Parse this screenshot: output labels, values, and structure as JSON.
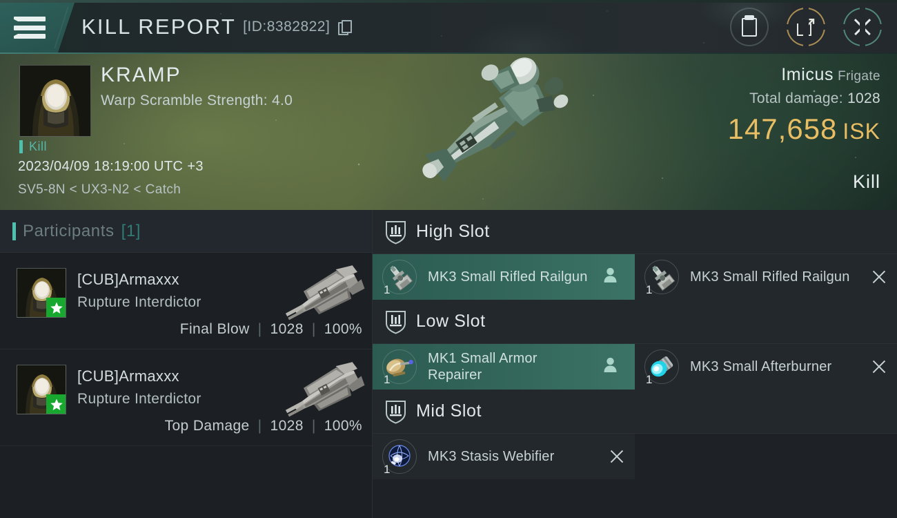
{
  "header": {
    "menu_icon": "hamburger-menu-icon",
    "title": "KILL REPORT",
    "report_id": "[ID:8382822]",
    "copy_icon": "copy-icon",
    "actions": [
      {
        "name": "clipboard-button",
        "icon": "clipboard-icon"
      },
      {
        "name": "share-button",
        "icon": "share-external-link-icon"
      },
      {
        "name": "close-button",
        "icon": "close-x-icon"
      }
    ]
  },
  "hero": {
    "victim_name": "KRAMP",
    "victim_stat": "Warp Scramble Strength: 4.0",
    "result_tag": "Kill",
    "timestamp": "2023/04/09 18:19:00 UTC +3",
    "location": "SV5-8N < UX3-N2 < Catch",
    "ship_name": "Imicus",
    "ship_class": "Frigate",
    "damage_label": "Total damage:",
    "damage_value": "1028",
    "isk_value": "147,658",
    "isk_unit": "ISK",
    "result_label": "Kill",
    "isk_color": "#e8bd63",
    "accent_color": "#4fbfae",
    "portrait_icon": "capsuleer-portrait",
    "ship_render_icon": "imicus-frigate-render"
  },
  "participants": {
    "title": "Participants",
    "count": "[1]",
    "rows": [
      {
        "name": "[CUB]Armaxxx",
        "ship": "Rupture Interdictor",
        "role": "Final Blow",
        "damage": "1028",
        "percent": "100%",
        "badge_icon": "star-badge-icon",
        "avatar_icon": "capsuleer-portrait",
        "ship_icon": "rupture-cruiser-thumbnail"
      },
      {
        "name": "[CUB]Armaxxx",
        "ship": "Rupture Interdictor",
        "role": "Top Damage",
        "damage": "1028",
        "percent": "100%",
        "badge_icon": "star-badge-icon",
        "avatar_icon": "capsuleer-portrait",
        "ship_icon": "rupture-cruiser-thumbnail"
      }
    ]
  },
  "slots": [
    {
      "title": "High Slot",
      "icon": "high-slot-shield-icon",
      "items": [
        {
          "name": "MK3 Small Rifled Railgun",
          "qty": "1",
          "state": "fitted",
          "state_icon": "person-icon",
          "icon": "railgun-module-icon"
        },
        {
          "name": "MK3 Small Rifled Railgun",
          "qty": "1",
          "state": "dropped",
          "state_icon": "x-icon",
          "icon": "railgun-module-icon"
        }
      ]
    },
    {
      "title": "Low Slot",
      "icon": "low-slot-shield-icon",
      "items": [
        {
          "name": "MK1 Small Armor Repairer",
          "qty": "1",
          "state": "fitted",
          "state_icon": "person-icon",
          "icon": "armor-repairer-module-icon"
        },
        {
          "name": "MK3 Small Afterburner",
          "qty": "1",
          "state": "dropped",
          "state_icon": "x-icon",
          "icon": "afterburner-module-icon"
        }
      ]
    },
    {
      "title": "Mid Slot",
      "icon": "mid-slot-shield-icon",
      "items": [
        {
          "name": "MK3 Stasis Webifier",
          "qty": "1",
          "state": "dropped",
          "state_icon": "x-icon",
          "icon": "stasis-webifier-module-icon"
        }
      ]
    }
  ]
}
